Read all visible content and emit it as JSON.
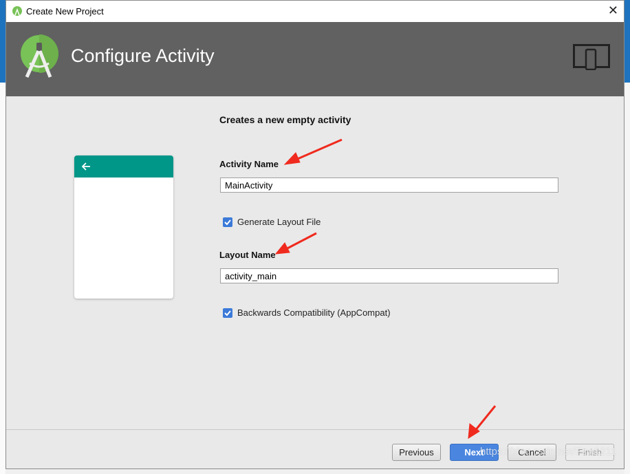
{
  "window": {
    "title": "Create New Project",
    "close_icon": "close-icon"
  },
  "header": {
    "title": "Configure Activity",
    "logo_icon": "android-studio-logo",
    "device_icon": "tablet-phone-icon"
  },
  "content": {
    "subtitle": "Creates a new empty activity",
    "activity_name": {
      "label": "Activity Name",
      "value": "MainActivity"
    },
    "generate_layout": {
      "label": "Generate Layout File",
      "checked": true
    },
    "layout_name": {
      "label": "Layout Name",
      "value": "activity_main"
    },
    "backwards_compat": {
      "label": "Backwards Compatibility (AppCompat)",
      "checked": true
    },
    "preview": {
      "toolbar_color": "#009688",
      "icon": "arrow-back-icon"
    }
  },
  "buttons": {
    "previous": "Previous",
    "next": "Next",
    "cancel": "Cancel",
    "finish": "Finish"
  },
  "colors": {
    "header": "#616161",
    "primary_button": "#4a86e0",
    "annotation_arrow": "#f02a1e"
  },
  "watermark": "https://blog.csdn.net/Fzw1211"
}
